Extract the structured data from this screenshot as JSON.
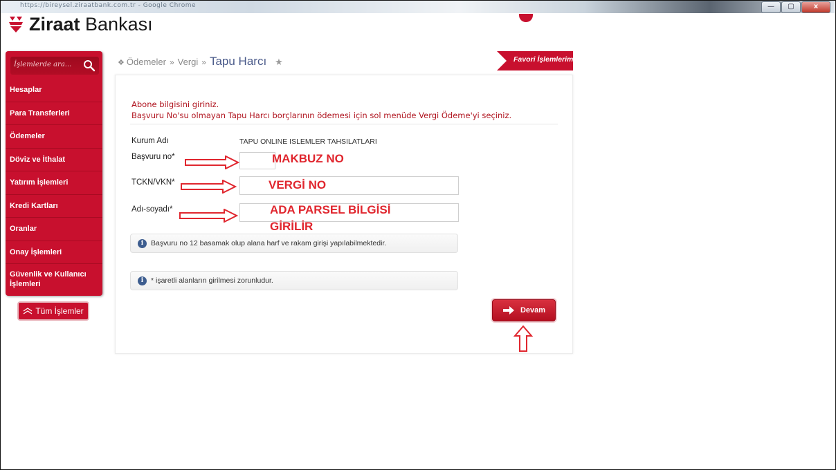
{
  "window": {
    "title_text": "https://bireysel.ziraatbank.com.tr - Google Chrome",
    "minimize": "—",
    "maximize": "▢",
    "close": "x"
  },
  "brand": {
    "name_bold": "Ziraat",
    "name_rest": " Bankası",
    "accent_color": "#c8102e"
  },
  "sidebar": {
    "search_placeholder": "İşlemlerde ara...",
    "items": [
      {
        "label": "Hesaplar"
      },
      {
        "label": "Para Transferleri"
      },
      {
        "label": "Ödemeler"
      },
      {
        "label": "Döviz ve İthalat"
      },
      {
        "label": "Yatırım İşlemleri"
      },
      {
        "label": "Kredi Kartları"
      },
      {
        "label": "Oranlar"
      },
      {
        "label": "Onay İşlemleri"
      },
      {
        "label": "Güvenlik ve Kullanıcı İşlemleri"
      }
    ],
    "all_button": "Tüm İşlemler"
  },
  "breadcrumb": {
    "home_icon": "home-icon",
    "items": [
      "Ödemeler",
      "Vergi"
    ],
    "separator": "»",
    "current": "Tapu Harcı"
  },
  "favorites_label": "Favori İşlemlerim",
  "form": {
    "intro_line1": "Abone bilgisini giriniz.",
    "intro_line2": "Başvuru No'su olmayan Tapu Harcı borçlarının ödemesi için sol menüde Vergi Ödeme'yi seçiniz.",
    "institution_label": "Kurum Adı",
    "institution_value": "TAPU ONLINE ISLEMLER TAHSILATLARI",
    "application_label": "Başvuru no*",
    "application_value": "",
    "tax_label": "TCKN/VKN*",
    "tax_value": "",
    "name_label": "Adı-soyadı*",
    "name_value": "",
    "info1": "Başvuru no 12 basamak olup alana harf ve rakam girişi yapılabilmektedir.",
    "info2": "* işaretli alanların girilmesi zorunludur.",
    "continue_button": "Devam"
  },
  "annotations": {
    "application": "MAKBUZ NO",
    "tax": "VERGİ NO",
    "name_line1": "ADA PARSEL BİLGİSİ",
    "name_line2": "GİRİLİR",
    "color": "#e0262e"
  }
}
